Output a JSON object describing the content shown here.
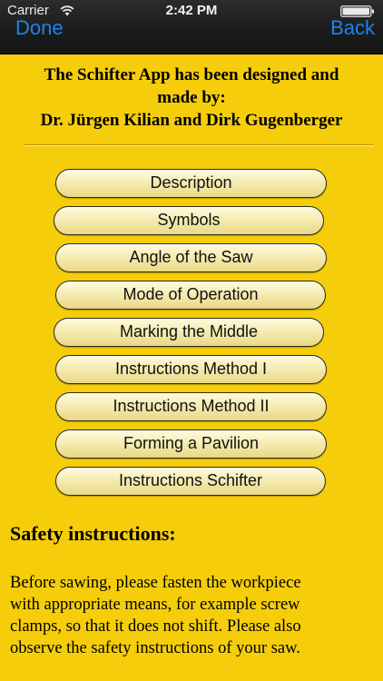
{
  "status_bar": {
    "carrier": "Carrier",
    "time": "2:42 PM",
    "wifi_icon": "wifi-icon",
    "battery_icon": "battery-full-icon"
  },
  "nav": {
    "done_label": "Done",
    "back_label": "Back",
    "tint_color": "#1f82ec"
  },
  "credits": {
    "lines": [
      "The Schifter App has been designed and",
      "made by:",
      "Dr. Jürgen Kilian and Dirk Gugenberger"
    ]
  },
  "menu": {
    "items": [
      {
        "label": "Description"
      },
      {
        "label": "Symbols"
      },
      {
        "label": "Angle of the Saw"
      },
      {
        "label": "Mode of Operation"
      },
      {
        "label": "Marking the Middle"
      },
      {
        "label": "Instructions Method I"
      },
      {
        "label": "Instructions Method II"
      },
      {
        "label": "Forming a Pavilion"
      },
      {
        "label": "Instructions Schifter"
      }
    ]
  },
  "safety": {
    "title": "Safety instructions:",
    "lines": [
      "Before sawing, please fasten the workpiece",
      "with appropriate means, for example screw",
      "clamps, so that it does not shift. Please also",
      "observe the safety instructions of your saw."
    ]
  },
  "colors": {
    "background": "#f5cd0a",
    "nav_bar": "#1c1c1c",
    "button_fill": "#f6ecb3",
    "button_border": "#2e2a18"
  }
}
